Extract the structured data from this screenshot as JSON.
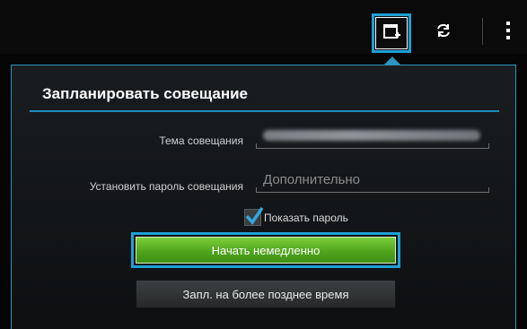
{
  "action_bar": {
    "schedule_icon": "calendar-plus-icon",
    "sync_icon": "refresh-icon",
    "overflow_icon": "overflow-menu-icon"
  },
  "dialog": {
    "title": "Запланировать совещание",
    "topic_label": "Тема совещания",
    "topic_value": "",
    "password_label": "Установить пароль совещания",
    "password_placeholder": "Дополнительно",
    "show_password_label": "Показать пароль",
    "show_password_checked": true,
    "start_now_label": "Начать немедленно",
    "schedule_later_label": "Запл. на более позднее время"
  },
  "colors": {
    "accent": "#1ea0d6",
    "start_button": "#5fb82a"
  }
}
